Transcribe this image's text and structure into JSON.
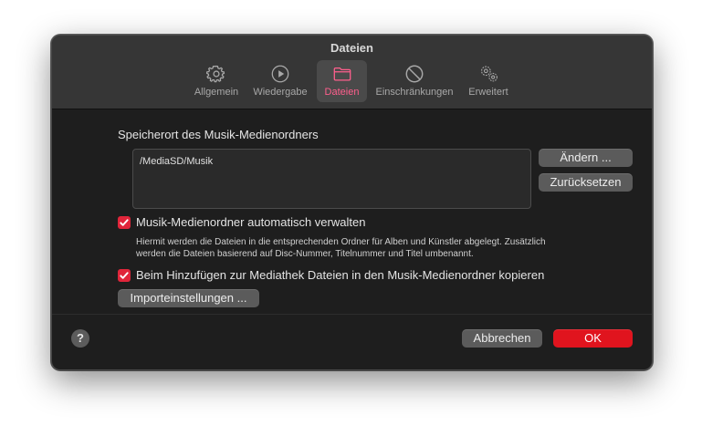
{
  "window": {
    "title": "Dateien"
  },
  "tabs": [
    {
      "label": "Allgemein",
      "icon": "gear-icon"
    },
    {
      "label": "Wiedergabe",
      "icon": "play-circle-icon"
    },
    {
      "label": "Dateien",
      "icon": "folder-icon",
      "active": true
    },
    {
      "label": "Einschränkungen",
      "icon": "prohibited-icon"
    },
    {
      "label": "Erweitert",
      "icon": "gears-icon"
    }
  ],
  "media_folder": {
    "label": "Speicherort des Musik-Medienordners",
    "path": "/MediaSD/Musik",
    "change_button": "Ändern ...",
    "reset_button": "Zurücksetzen"
  },
  "options": {
    "manage": {
      "label": "Musik-Medienordner automatisch verwalten",
      "checked": true,
      "description_line1": "Hiermit werden die Dateien in die entsprechenden Ordner für Alben und Künstler abgelegt. Zusätzlich",
      "description_line2": "werden die Dateien basierend auf Disc-Nummer, Titelnummer und Titel umbenannt."
    },
    "copy": {
      "label": "Beim Hinzufügen zur Mediathek Dateien in den Musik-Medienordner kopieren",
      "checked": true
    },
    "import_button": "Importeinstellungen ..."
  },
  "footer": {
    "help": "?",
    "cancel_button": "Abbrechen",
    "ok_button": "OK"
  },
  "colors": {
    "accent": "#ff5f8d",
    "checkbox": "#e0253a",
    "ok_button": "#e0141e",
    "window_bg": "#1e1e1e",
    "titlebar_bg": "#363636"
  }
}
